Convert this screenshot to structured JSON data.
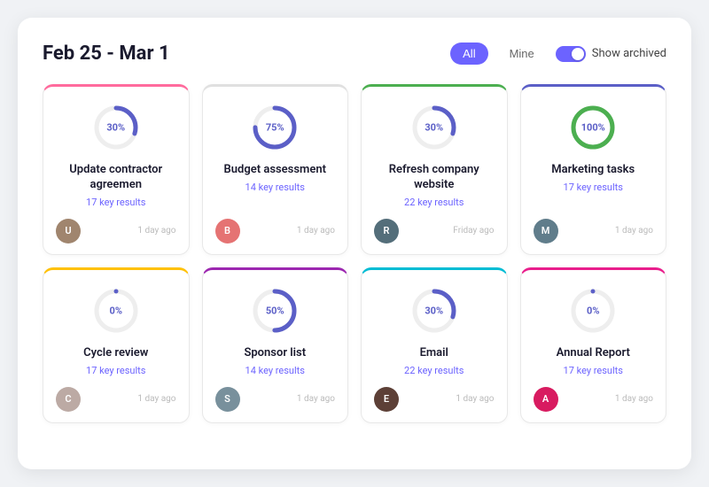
{
  "header": {
    "title": "Feb 25 - Mar 1",
    "filter_all": "All",
    "filter_mine": "Mine",
    "show_archived": "Show archived"
  },
  "cards": [
    {
      "id": "card-1",
      "title": "Update contractor agreemen",
      "key_results": "17 key results",
      "percent": 30,
      "time": "1 day ago",
      "color_class": "color-pink",
      "donut_color": "#6c63ff",
      "avatar_bg": "#8d6e63",
      "avatar_initials": "U"
    },
    {
      "id": "card-2",
      "title": "Budget assessment",
      "key_results": "14 key results",
      "percent": 75,
      "time": "1 day ago",
      "color_class": "color-gray",
      "donut_color": "#6c63ff",
      "avatar_bg": "#e57373",
      "avatar_initials": "B"
    },
    {
      "id": "card-3",
      "title": "Refresh company website",
      "key_results": "22 key results",
      "percent": 30,
      "time": "Friday ago",
      "color_class": "color-green",
      "donut_color": "#6c63ff",
      "avatar_bg": "#37474f",
      "avatar_initials": "R"
    },
    {
      "id": "card-4",
      "title": "Marketing tasks",
      "key_results": "17 key results",
      "percent": 100,
      "time": "1 day ago",
      "color_class": "color-indigo",
      "donut_color": "#4caf50",
      "avatar_bg": "#5d6e7a",
      "avatar_initials": "M"
    },
    {
      "id": "card-5",
      "title": "Cycle review",
      "key_results": "17 key results",
      "percent": 0,
      "time": "1 day ago",
      "color_class": "color-yellow",
      "donut_color": "#6c63ff",
      "avatar_bg": "#b08860",
      "avatar_initials": "C"
    },
    {
      "id": "card-6",
      "title": "Sponsor list",
      "key_results": "14 key results",
      "percent": 50,
      "time": "1 day ago",
      "color_class": "color-purple",
      "donut_color": "#6c63ff",
      "avatar_bg": "#78909c",
      "avatar_initials": "S"
    },
    {
      "id": "card-7",
      "title": "Email",
      "key_results": "22 key results",
      "percent": 30,
      "time": "1 day ago",
      "color_class": "color-cyan",
      "donut_color": "#6c63ff",
      "avatar_bg": "#5d4037",
      "avatar_initials": "E"
    },
    {
      "id": "card-8",
      "title": "Annual Report",
      "key_results": "17 key results",
      "percent": 0,
      "time": "1 day ago",
      "color_class": "color-magenta",
      "donut_color": "#6c63ff",
      "avatar_bg": "#d81b60",
      "avatar_initials": "A"
    }
  ]
}
